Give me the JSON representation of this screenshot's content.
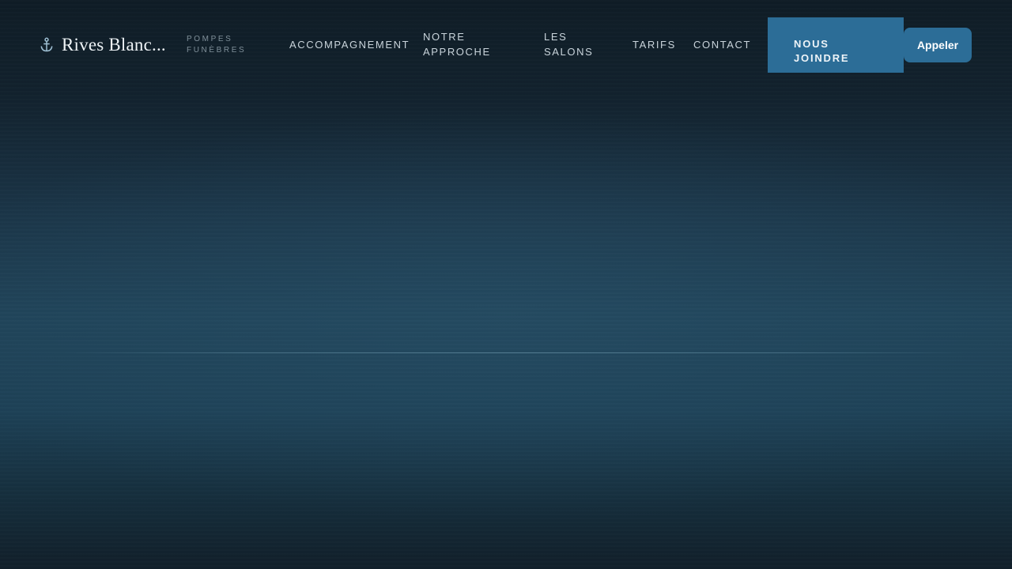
{
  "brand": {
    "name": "Rives Blanc...",
    "tagline_line1": "POMPES",
    "tagline_line2": "FUNÈBRES",
    "icon": "anchor-icon"
  },
  "nav": {
    "items": [
      {
        "lines": [
          "ACCOMPAGNEMENT"
        ]
      },
      {
        "lines": [
          "NOTRE",
          "APPROCHE"
        ]
      },
      {
        "lines": [
          "LES",
          "SALONS"
        ]
      },
      {
        "lines": [
          "TARIFS"
        ]
      },
      {
        "lines": [
          "CONTACT"
        ]
      }
    ]
  },
  "cta": {
    "contact_line1": "NOUS",
    "contact_line2": "JOINDRE",
    "call_label": "Appeler"
  },
  "colors": {
    "accent": "#2c6d97",
    "background_dark": "#0f1c26",
    "background_mid": "#204459",
    "nav_text": "#c9d4db"
  }
}
